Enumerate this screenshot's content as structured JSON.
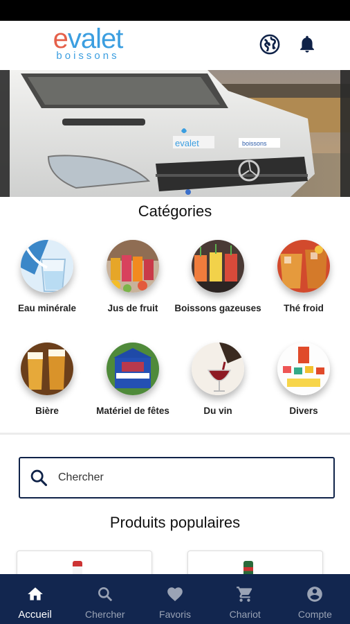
{
  "header": {
    "logo_main": "evalet",
    "logo_accent": "e",
    "logo_rest": "valet",
    "logo_sub": "boissons",
    "icons": [
      "globe-icon",
      "bell-icon"
    ]
  },
  "banner": {
    "vehicle_brand_text": "evalet",
    "vehicle_side_text": "boissons"
  },
  "categories": {
    "title": "Catégories",
    "items": [
      {
        "label": "Eau minérale",
        "icon": "water-glass-image"
      },
      {
        "label": "Jus de fruit",
        "icon": "fruit-juice-image"
      },
      {
        "label": "Boissons gazeuses",
        "icon": "soda-drinks-image"
      },
      {
        "label": "Thé froid",
        "icon": "iced-tea-image"
      },
      {
        "label": "Bière",
        "icon": "beer-glasses-image"
      },
      {
        "label": "Matériel de fêtes",
        "icon": "party-tent-image"
      },
      {
        "label": "Du vin",
        "icon": "wine-pour-image"
      },
      {
        "label": "Divers",
        "icon": "misc-products-image"
      }
    ]
  },
  "search": {
    "placeholder": "Chercher",
    "value": ""
  },
  "popular": {
    "title": "Produits populaires"
  },
  "bottom_nav": {
    "items": [
      {
        "label": "Accueil",
        "icon": "home-icon",
        "active": true
      },
      {
        "label": "Chercher",
        "icon": "search-icon",
        "active": false
      },
      {
        "label": "Favoris",
        "icon": "heart-icon",
        "active": false
      },
      {
        "label": "Chariot",
        "icon": "cart-icon",
        "active": false
      },
      {
        "label": "Compte",
        "icon": "account-icon",
        "active": false
      }
    ]
  },
  "colors": {
    "brand_blue": "#3b9ee0",
    "brand_orange": "#e5604a",
    "nav_bg": "#12264f",
    "icon_dark": "#0f2248"
  }
}
